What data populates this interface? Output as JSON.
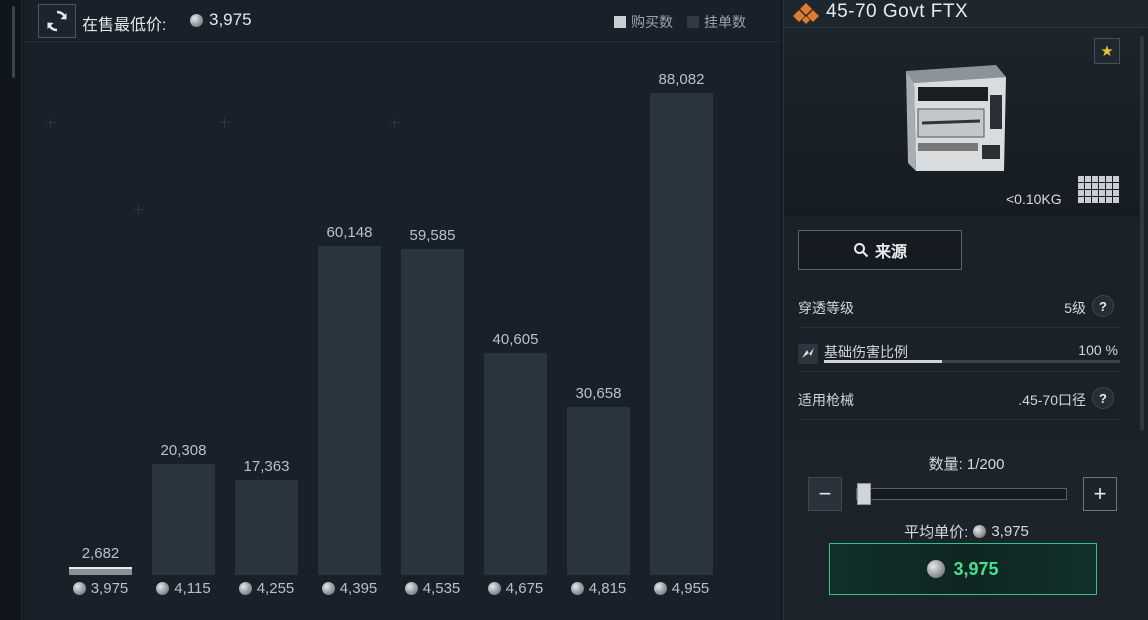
{
  "header": {
    "lowest_label": "在售最低价:",
    "lowest_price": "3,975",
    "legend_buy": "购买数",
    "legend_list": "挂单数"
  },
  "colors": {
    "buy_bar": "#c9ced3",
    "list_bar": "#2a343e",
    "accent_green": "#46e08e",
    "star": "#e5c23a"
  },
  "chart_data": {
    "type": "bar",
    "categories": [
      "3,975",
      "4,115",
      "4,255",
      "4,395",
      "4,535",
      "4,675",
      "4,815",
      "4,955"
    ],
    "series": [
      {
        "name": "购买数",
        "values": [
          2682,
          0,
          0,
          0,
          0,
          0,
          0,
          0
        ]
      },
      {
        "name": "挂单数",
        "values": [
          0,
          20308,
          17363,
          60148,
          59585,
          40605,
          30658,
          88082
        ]
      }
    ],
    "value_labels": [
      "2,682",
      "20,308",
      "17,363",
      "60,148",
      "59,585",
      "40,605",
      "30,658",
      "88,082"
    ],
    "ylim": [
      0,
      88082
    ],
    "legend": "top-right",
    "grid": false
  },
  "item": {
    "name": "45-70 Govt FTX",
    "weight": "<0.10KG",
    "source_label": "来源",
    "stats": [
      {
        "label": "穿透等级",
        "value": "5级"
      },
      {
        "label": "基础伤害比例",
        "value": "100 %",
        "bar_fraction": 0.4
      },
      {
        "label": "适用枪械",
        "value": ".45-70口径"
      }
    ],
    "icons": {
      "brand": "diamond-logo-icon",
      "favorite": "star-icon",
      "damage": "damage-icon",
      "help": "question-icon"
    }
  },
  "purchase": {
    "quantity_label": "数量: 1/200",
    "quantity": 1,
    "max": 200,
    "minus": "−",
    "plus": "+",
    "avg_label": "平均单价:",
    "avg_price": "3,975",
    "total_price": "3,975"
  }
}
